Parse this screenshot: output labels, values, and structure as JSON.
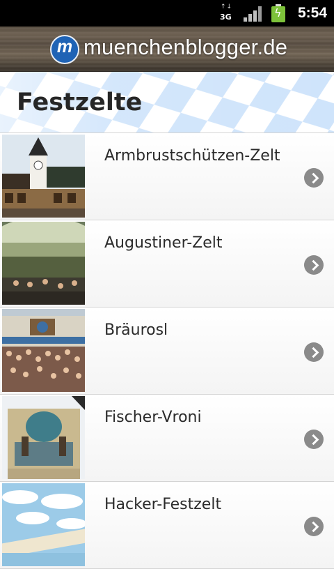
{
  "status_bar": {
    "network": "3G",
    "time": "5:54"
  },
  "header": {
    "logo_letter": "m",
    "site_name": "muenchenblogger.de"
  },
  "page": {
    "title": "Festzelte"
  },
  "tents": [
    {
      "label": "Armbrustschützen-Zelt",
      "thumb": "tent-facade-photo"
    },
    {
      "label": "Augustiner-Zelt",
      "thumb": "tent-interior-photo"
    },
    {
      "label": "Bräurosl",
      "thumb": "tent-crowd-photo"
    },
    {
      "label": "Fischer-Vroni",
      "thumb": "tent-painting-photo"
    },
    {
      "label": "Hacker-Festzelt",
      "thumb": "tent-sky-ceiling-photo"
    }
  ],
  "icons": {
    "row_action": "chevron-right-icon"
  },
  "colors": {
    "status_bar": "#000000",
    "header_wood": "#5b5043",
    "logo_blue": "#1f63b5",
    "bavarian_blue": "#cde3fa",
    "chevron": "#8a8a8a"
  }
}
